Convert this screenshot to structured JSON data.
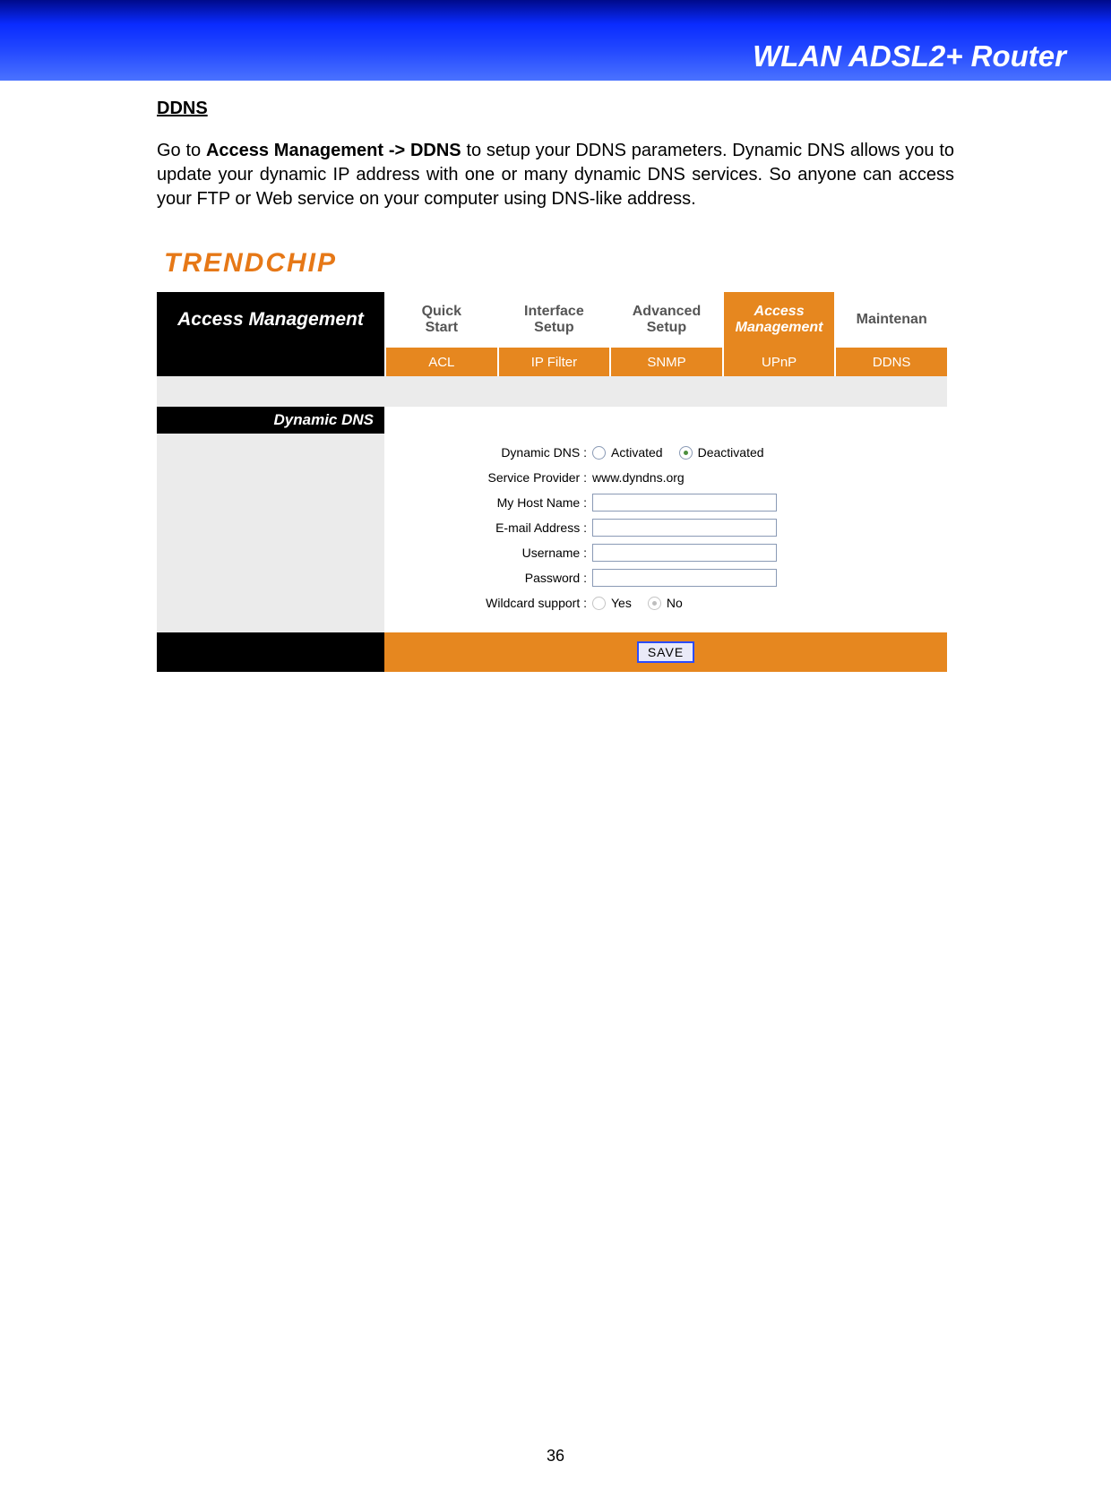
{
  "header": {
    "title": "WLAN ADSL2+ Router"
  },
  "section": {
    "heading": "DDNS",
    "body_plain_pre": "Go to ",
    "body_bold": "Access Management -> DDNS",
    "body_plain_post": " to setup your DDNS parameters. Dynamic DNS allows you to update your dynamic IP address with one or many dynamic DNS services. So anyone can access your FTP or Web service on your computer using DNS-like address."
  },
  "router": {
    "logo": "TRENDCHIP",
    "current_section": "Access\nManagement",
    "tabs": [
      {
        "label": "Quick\nStart"
      },
      {
        "label": "Interface\nSetup"
      },
      {
        "label": "Advanced\nSetup"
      },
      {
        "label": "Access\nManagement",
        "active": true
      },
      {
        "label": "Maintenan"
      }
    ],
    "subtabs": [
      "ACL",
      "IP Filter",
      "SNMP",
      "UPnP",
      "DDNS"
    ],
    "section_title": "Dynamic DNS",
    "form": {
      "dyn_label": "Dynamic DNS :",
      "dyn_opt1": "Activated",
      "dyn_opt2": "Deactivated",
      "dyn_selected": "Deactivated",
      "sp_label": "Service Provider :",
      "sp_value": "www.dyndns.org",
      "host_label": "My Host Name :",
      "host_value": "",
      "email_label": "E-mail Address :",
      "email_value": "",
      "user_label": "Username :",
      "user_value": "",
      "pass_label": "Password :",
      "pass_value": "",
      "wildcard_label": "Wildcard support :",
      "wildcard_opt1": "Yes",
      "wildcard_opt2": "No",
      "wildcard_selected": "No"
    },
    "save_label": "SAVE"
  },
  "page_number": "36"
}
